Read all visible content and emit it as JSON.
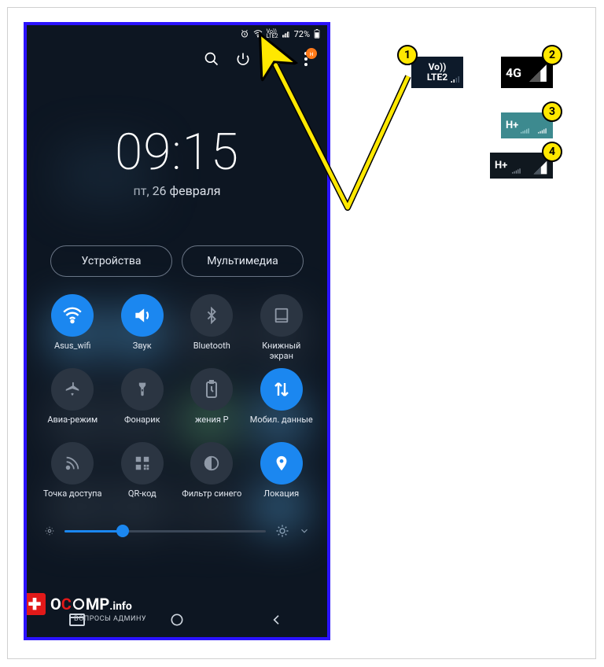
{
  "statusbar": {
    "lte_mini": "Vo))\nLTE2",
    "battery_pct": "72%"
  },
  "clock": {
    "time": "09:15",
    "date": "пт, 26 февраля"
  },
  "pills": {
    "devices": "Устройства",
    "media": "Мультимедиа"
  },
  "tiles": [
    {
      "label": "Asus_wifi",
      "active": true
    },
    {
      "label": "Звук",
      "active": true
    },
    {
      "label": "Bluetooth",
      "active": false
    },
    {
      "label": "Книжный экран",
      "active": false
    },
    {
      "label": "Авиа-режим",
      "active": false
    },
    {
      "label": "Фонарик",
      "active": false
    },
    {
      "label": "жения   Р",
      "active": false
    },
    {
      "label": "Мобил. данные",
      "active": true
    },
    {
      "label": "Точка доступа",
      "active": false
    },
    {
      "label": "QR-код",
      "active": false
    },
    {
      "label": "Фильтр синего",
      "active": false
    },
    {
      "label": "Локация",
      "active": true
    }
  ],
  "watermark": {
    "brand1": "O",
    "brand2": "C",
    "brand3": "MP",
    "tld": ".info",
    "sub": "ВОПРОСЫ АДМИНУ"
  },
  "callouts": {
    "n1": "1",
    "n2": "2",
    "n3": "3",
    "n4": "4",
    "box1": "Vo))\nLTE2",
    "box2": "4G",
    "box3": "H+",
    "box4": "H+"
  },
  "brightness": {
    "pct": 29
  },
  "notif_badge": "н"
}
